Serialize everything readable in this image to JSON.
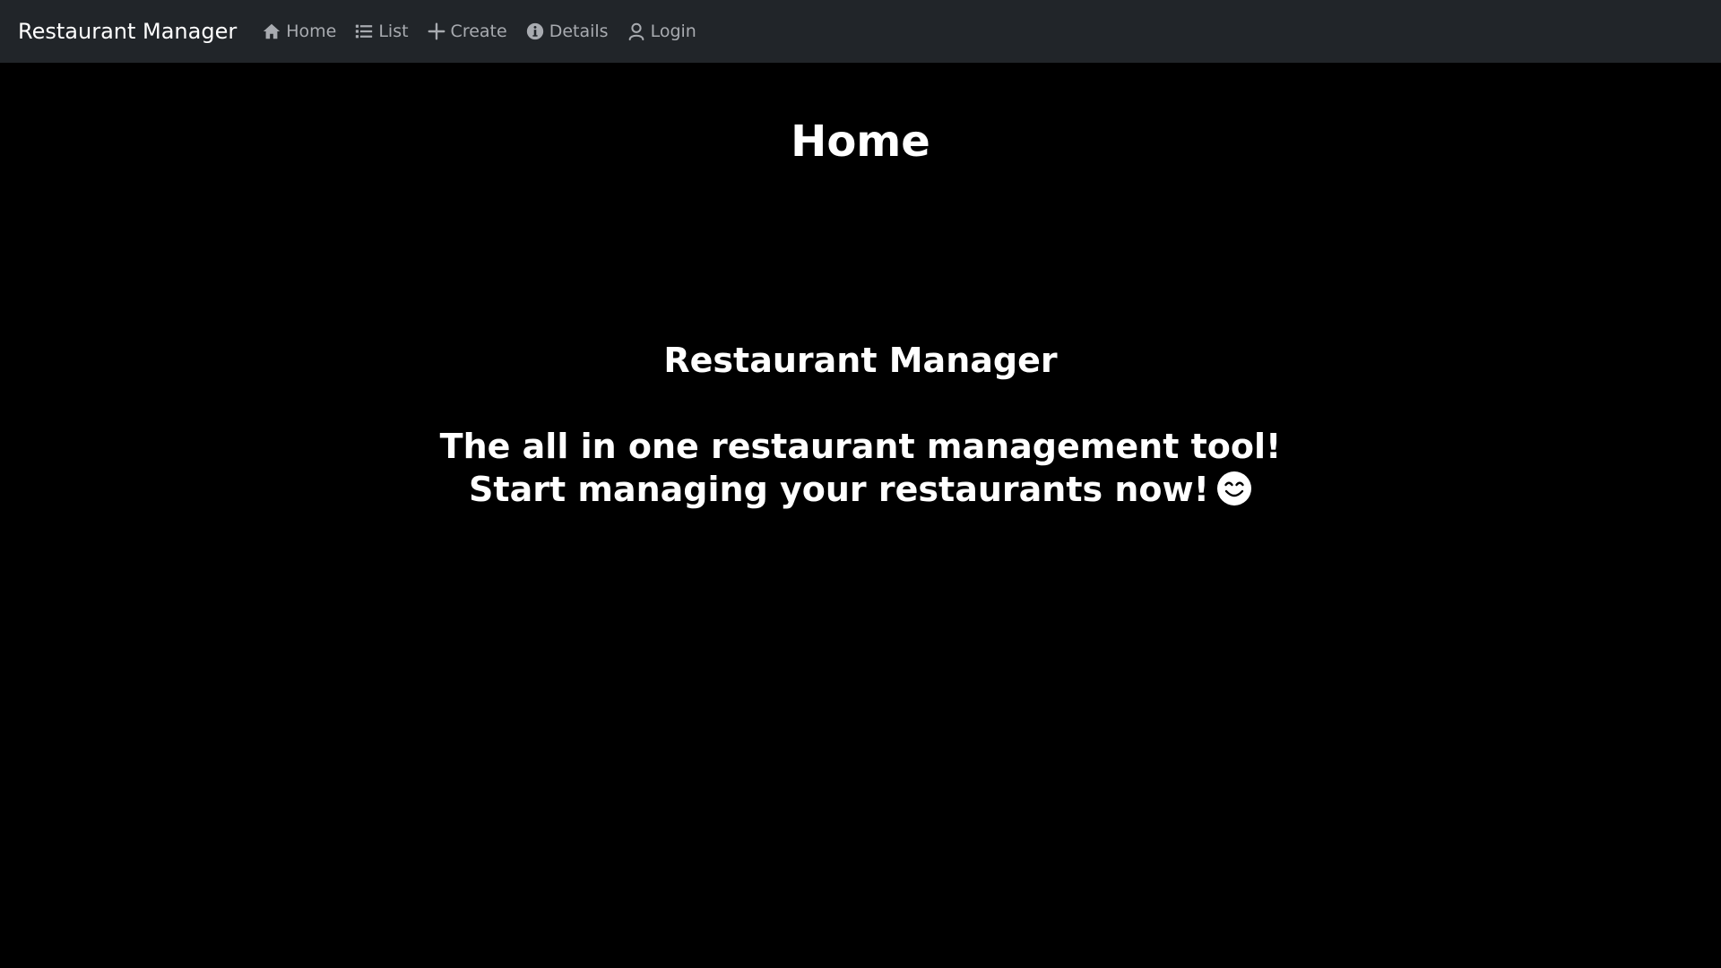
{
  "navbar": {
    "brand": "Restaurant Manager",
    "links": [
      {
        "label": "Home",
        "icon": "home-icon"
      },
      {
        "label": "List",
        "icon": "list-icon"
      },
      {
        "label": "Create",
        "icon": "plus-icon"
      },
      {
        "label": "Details",
        "icon": "info-icon"
      },
      {
        "label": "Login",
        "icon": "user-icon"
      }
    ],
    "background": "#212529",
    "link_color": "#a8abb0"
  },
  "main": {
    "page_title": "Home",
    "hero_title": "Restaurant Manager",
    "tagline_line1": "The all in one restaurant management tool!",
    "tagline_line2": "Start managing your restaurants now!",
    "tagline_icon": "smiley-face-icon",
    "background": "#000000",
    "text_color": "#ffffff"
  }
}
